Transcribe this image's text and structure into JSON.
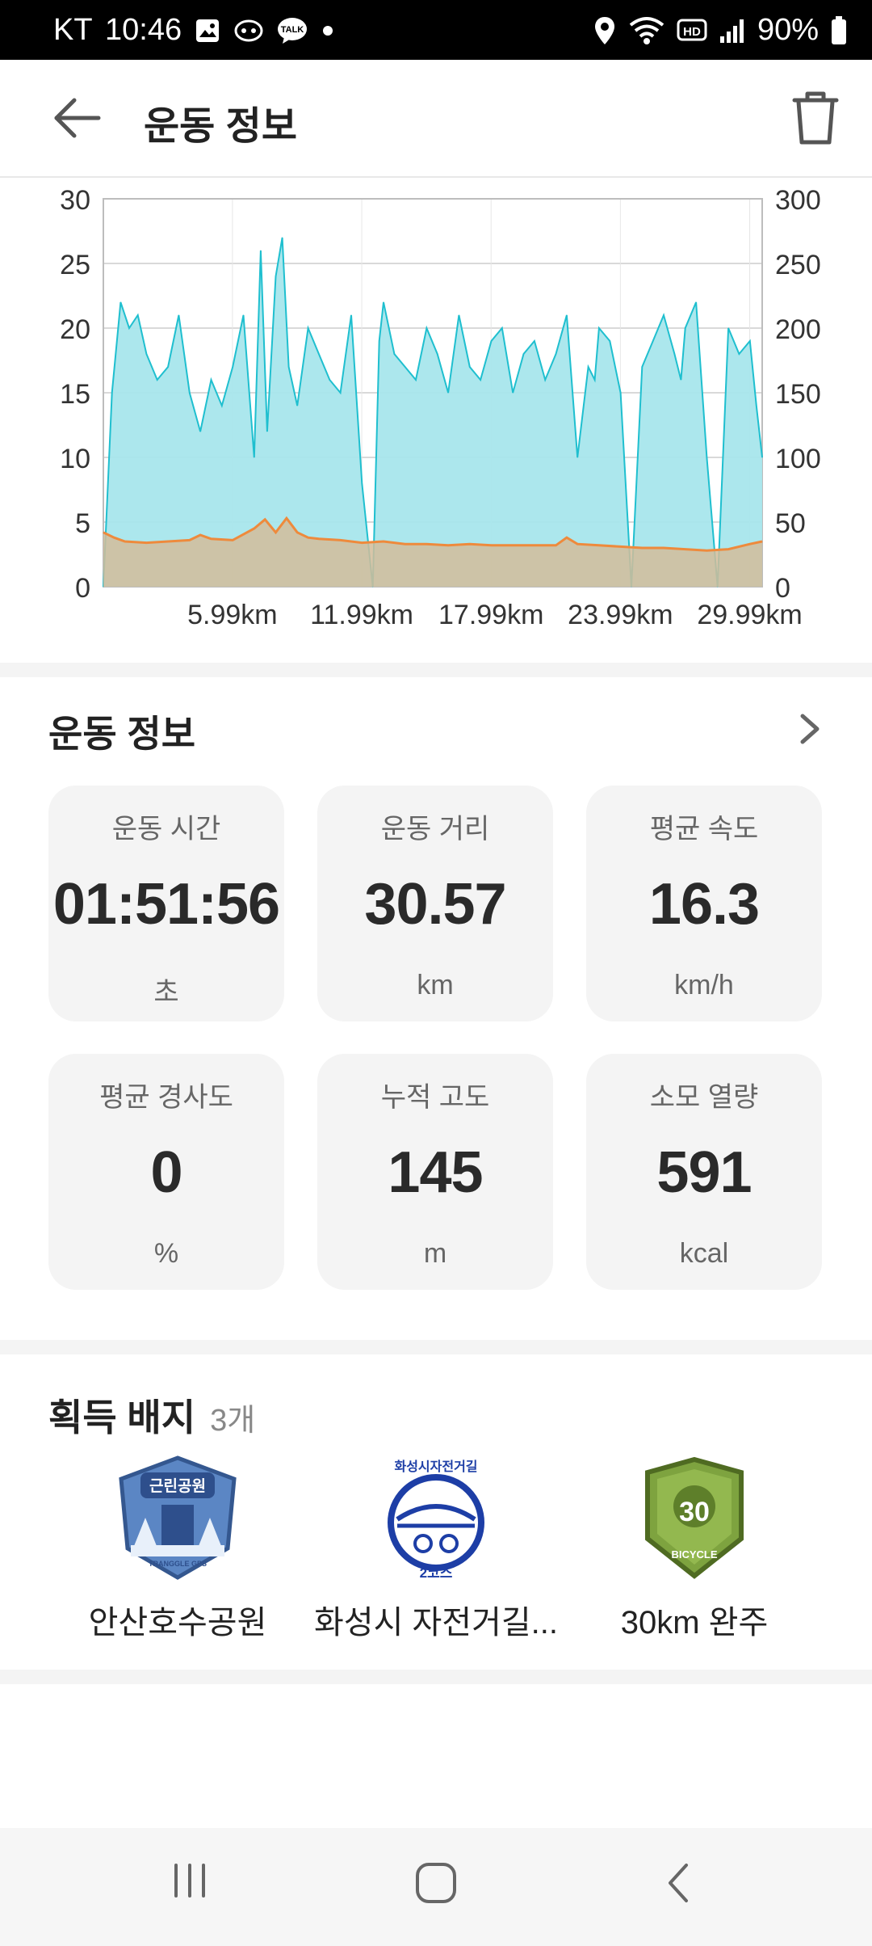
{
  "status_bar": {
    "carrier": "KT",
    "time": "10:46",
    "battery": "90%",
    "icons": [
      "gallery-icon",
      "app-icon",
      "talk-icon",
      "dot-icon",
      "location-icon",
      "wifi-icon",
      "hd-icon",
      "signal-icon",
      "battery-icon"
    ]
  },
  "header": {
    "title": "운동 정보"
  },
  "chart_data": {
    "type": "area",
    "x_tick_labels": [
      "5.99km",
      "11.99km",
      "17.99km",
      "23.99km",
      "29.99km"
    ],
    "x_ticks_km": [
      5.99,
      11.99,
      17.99,
      23.99,
      29.99
    ],
    "xlim": [
      0,
      30.57
    ],
    "y_left_ticks": [
      "0",
      "5",
      "10",
      "15",
      "20",
      "25",
      "30"
    ],
    "ylim_left": [
      0,
      30
    ],
    "y_right_ticks": [
      "0",
      "50",
      "100",
      "150",
      "200",
      "250",
      "300"
    ],
    "ylim_right": [
      0,
      300
    ],
    "grid": true,
    "series": [
      {
        "color": "#1fbfcf",
        "fill": "#a8e6ec",
        "x": [
          0,
          0.4,
          0.8,
          1.2,
          1.6,
          2.0,
          2.5,
          3.0,
          3.5,
          4.0,
          4.5,
          5.0,
          5.5,
          6.0,
          6.5,
          7.0,
          7.3,
          7.6,
          8.0,
          8.3,
          8.6,
          9.0,
          9.5,
          10.0,
          10.5,
          11.0,
          11.5,
          12.0,
          12.5,
          12.8,
          13.0,
          13.5,
          14.0,
          14.5,
          15.0,
          15.5,
          16.0,
          16.5,
          17.0,
          17.5,
          18.0,
          18.5,
          19.0,
          19.5,
          20.0,
          20.5,
          21.0,
          21.5,
          22.0,
          22.5,
          22.8,
          23.0,
          23.5,
          24.0,
          24.5,
          25.0,
          25.5,
          26.0,
          26.5,
          26.8,
          27.0,
          27.5,
          28.0,
          28.5,
          29.0,
          29.5,
          30.0,
          30.3,
          30.57
        ],
        "values": [
          0,
          15,
          22,
          20,
          21,
          18,
          16,
          17,
          21,
          15,
          12,
          16,
          14,
          17,
          21,
          10,
          26,
          12,
          24,
          27,
          17,
          14,
          20,
          18,
          16,
          15,
          21,
          8,
          0,
          19,
          22,
          18,
          17,
          16,
          20,
          18,
          15,
          21,
          17,
          16,
          19,
          20,
          15,
          18,
          19,
          16,
          18,
          21,
          10,
          17,
          16,
          20,
          19,
          15,
          0,
          17,
          19,
          21,
          18,
          16,
          20,
          22,
          10,
          0,
          20,
          18,
          19,
          14,
          10
        ]
      },
      {
        "color": "#ee8a3c",
        "fill": "#d2bc9a",
        "x": [
          0,
          0.5,
          1.0,
          2.0,
          3.0,
          4.0,
          4.5,
          5.0,
          6.0,
          7.0,
          7.5,
          8.0,
          8.5,
          9.0,
          9.5,
          10.0,
          11.0,
          12.0,
          13.0,
          14.0,
          15.0,
          16.0,
          17.0,
          18.0,
          19.0,
          20.0,
          21.0,
          21.5,
          22.0,
          23.0,
          24.0,
          25.0,
          26.0,
          27.0,
          28.0,
          29.0,
          30.0,
          30.57
        ],
        "values": [
          42,
          38,
          35,
          34,
          35,
          36,
          40,
          37,
          36,
          45,
          52,
          42,
          53,
          42,
          38,
          37,
          36,
          34,
          35,
          33,
          33,
          32,
          33,
          32,
          32,
          32,
          32,
          38,
          33,
          32,
          31,
          30,
          30,
          29,
          28,
          29,
          33,
          35
        ]
      }
    ]
  },
  "workout": {
    "section_title": "운동 정보",
    "stats": [
      {
        "label": "운동 시간",
        "value": "01:51:56",
        "unit": "초"
      },
      {
        "label": "운동 거리",
        "value": "30.57",
        "unit": "km"
      },
      {
        "label": "평균 속도",
        "value": "16.3",
        "unit": "km/h"
      },
      {
        "label": "평균 경사도",
        "value": "0",
        "unit": "%"
      },
      {
        "label": "누적 고도",
        "value": "145",
        "unit": "m"
      },
      {
        "label": "소모 열량",
        "value": "591",
        "unit": "kcal"
      }
    ]
  },
  "badges": {
    "title": "획득 배지",
    "count": "3개",
    "items": [
      {
        "name": "안산호수공원",
        "icon": "park-badge-icon",
        "badge_text": "근린공원",
        "sub_text": "TRANGGLE GPS",
        "color": "#4d79b8"
      },
      {
        "name": "화성시 자전거길...",
        "icon": "bike-path-badge-icon",
        "badge_text": "화성시자전거길",
        "sub_text": "2코스",
        "color": "#1d3ea6"
      },
      {
        "name": "30km 완주",
        "icon": "30km-badge-icon",
        "badge_text": "30",
        "sub_text": "BICYCLE",
        "color": "#7ea33f"
      }
    ]
  },
  "nav": {
    "icons": [
      "recent-apps-icon",
      "home-icon",
      "back-nav-icon"
    ]
  }
}
